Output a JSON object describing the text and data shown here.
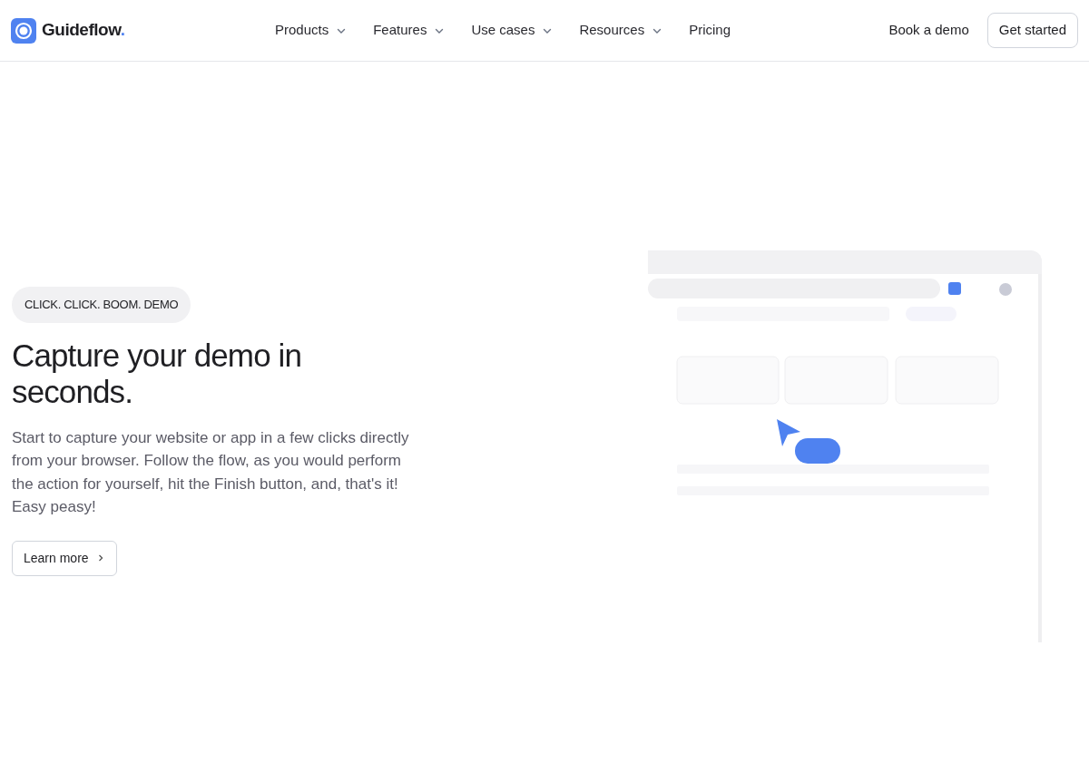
{
  "header": {
    "logo": "Guideflow",
    "logo_dot": ".",
    "nav": [
      {
        "label": "Products",
        "dropdown": true
      },
      {
        "label": "Features",
        "dropdown": true
      },
      {
        "label": "Use cases",
        "dropdown": true
      },
      {
        "label": "Resources",
        "dropdown": true
      },
      {
        "label": "Pricing",
        "dropdown": false
      }
    ],
    "book_demo": "Book a demo",
    "get_started": "Get started"
  },
  "hero": {
    "eyebrow": "CLICK. CLICK. BOOM. DEMO",
    "title": "Capture your demo in seconds.",
    "body": "Start to capture your website or app in a few clicks directly from your browser. Follow the flow, as you would perform the action for yourself, hit the Finish button, and, that's it! Easy peasy!",
    "button": "Learn more"
  }
}
